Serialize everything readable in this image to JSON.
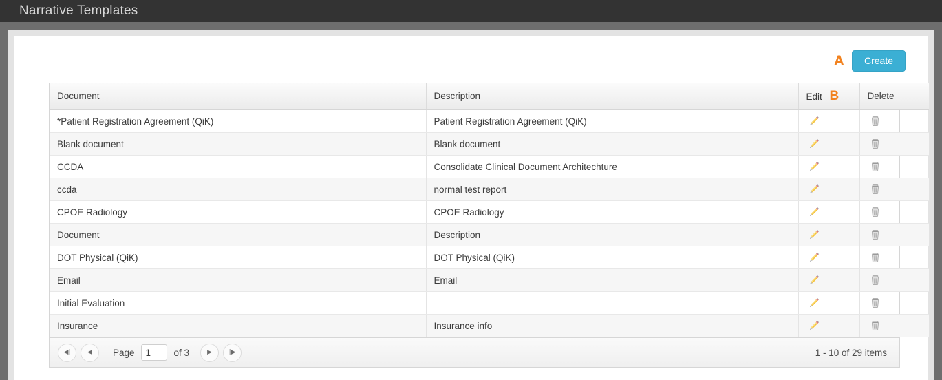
{
  "app": {
    "title": "Narrative Templates"
  },
  "toolbar": {
    "annotation_a": "A",
    "create_label": "Create"
  },
  "grid": {
    "annotation_b": "B",
    "columns": [
      {
        "key": "document",
        "label": "Document"
      },
      {
        "key": "description",
        "label": "Description"
      },
      {
        "key": "edit",
        "label": "Edit"
      },
      {
        "key": "delete",
        "label": "Delete"
      }
    ],
    "icons": {
      "edit": "pencil-icon",
      "delete": "trash-icon"
    },
    "rows": [
      {
        "document": "*Patient Registration Agreement (QiK)",
        "description": "Patient Registration Agreement (QiK)"
      },
      {
        "document": "Blank document",
        "description": "Blank document"
      },
      {
        "document": "CCDA",
        "description": "Consolidate Clinical Document Architechture"
      },
      {
        "document": "ccda",
        "description": "normal test report"
      },
      {
        "document": "CPOE Radiology",
        "description": "CPOE Radiology"
      },
      {
        "document": "Document",
        "description": "Description"
      },
      {
        "document": "DOT Physical (QiK)",
        "description": "DOT Physical (QiK)"
      },
      {
        "document": "Email",
        "description": "Email"
      },
      {
        "document": "Initial Evaluation",
        "description": ""
      },
      {
        "document": "Insurance",
        "description": "Insurance info"
      }
    ]
  },
  "pager": {
    "first_icon": "first-page-icon",
    "prev_icon": "previous-page-icon",
    "next_icon": "next-page-icon",
    "last_icon": "last-page-icon",
    "first_glyph": "◀|",
    "prev_glyph": "◀",
    "next_glyph": "▶",
    "last_glyph": "|▶",
    "page_label": "Page",
    "page_value": "1",
    "of_label": "of 3",
    "item_count": "1 - 10 of 29 items"
  },
  "colors": {
    "accent_button": "#3bafd4",
    "annotation": "#f2821f",
    "app_bar": "#333333",
    "chrome": "#6e6e6e"
  }
}
